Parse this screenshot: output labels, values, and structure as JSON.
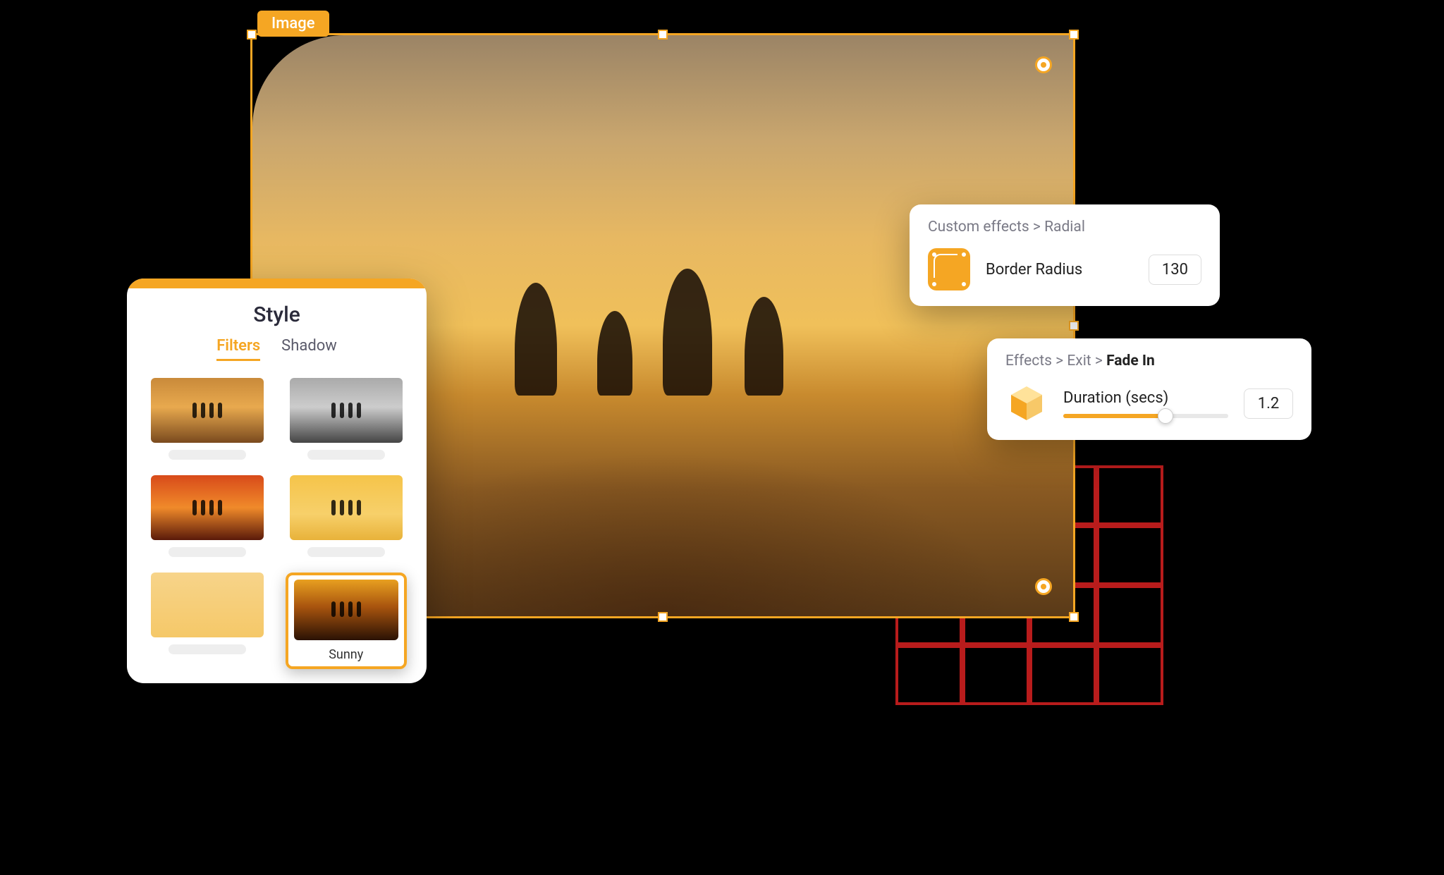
{
  "canvas": {
    "element_label": "Image"
  },
  "style_panel": {
    "title": "Style",
    "tabs": {
      "filters": "Filters",
      "shadow": "Shadow"
    },
    "selected_filter_name": "Sunny"
  },
  "card_radius": {
    "breadcrumb_prefix": "Custom effects > ",
    "breadcrumb_current": "Radial",
    "label": "Border Radius",
    "value": "130"
  },
  "card_effects": {
    "breadcrumb_prefix": "Effects > Exit > ",
    "breadcrumb_current": "Fade In",
    "label": "Duration (secs)",
    "value": "1.2"
  }
}
